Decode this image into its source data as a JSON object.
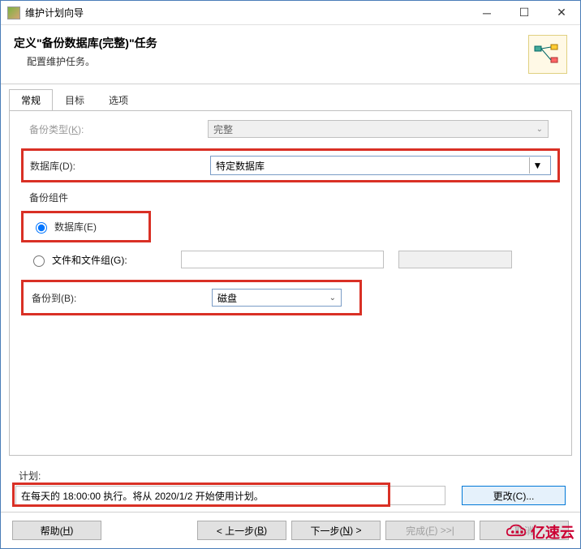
{
  "titlebar": {
    "title": "维护计划向导"
  },
  "header": {
    "title": "定义\"备份数据库(完整)\"任务",
    "subtitle": "配置维护任务。"
  },
  "tabs": {
    "general": "常规",
    "target": "目标",
    "options": "选项"
  },
  "form": {
    "backup_type_label": "备份类型(K):",
    "backup_type_value": "完整",
    "database_label": "数据库(D):",
    "database_value": "特定数据库",
    "backup_component_label": "备份组件",
    "radio_database": "数据库(E)",
    "radio_files": "文件和文件组(G):",
    "backup_to_label": "备份到(B):",
    "backup_to_value": "磁盘"
  },
  "schedule": {
    "label": "计划:",
    "text": "在每天的 18:00:00 执行。将从 2020/1/2 开始使用计划。",
    "change_btn": "更改(C)..."
  },
  "footer": {
    "help": "帮助(H)",
    "back": "< 上一步(B)",
    "next": "下一步(N) >",
    "finish": "完成(F) >>|",
    "cancel": "取消"
  },
  "watermark": "亿速云"
}
